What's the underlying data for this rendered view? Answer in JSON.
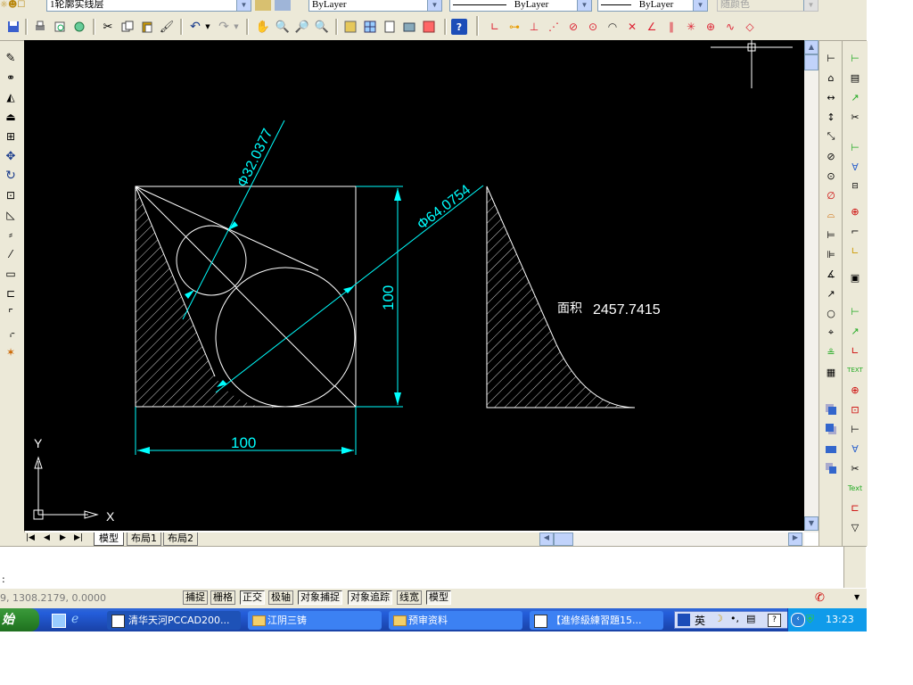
{
  "toolbar_top": {
    "layer_combo": "1轮廓实线层",
    "color_combo": "ByLayer",
    "linetype_combo": "ByLayer",
    "lineweight_combo": "ByLayer",
    "plotstyle_combo": "随颜色"
  },
  "drawing": {
    "dim_diameter_small": "Φ32.0377",
    "dim_diameter_large": "Φ64.0754",
    "dim_vertical": "100",
    "dim_horizontal": "100",
    "area_label": "面积",
    "area_value": "2457.7415",
    "ucs_y": "Y",
    "ucs_x": "X"
  },
  "layout_tabs": [
    "模型",
    "布局1",
    "布局2"
  ],
  "command": {
    "prompt": ":"
  },
  "status": {
    "coords": "9,  1308.2179,  0.0000",
    "buttons": [
      "捕捉",
      "栅格",
      "正交",
      "极轴",
      "对象捕捉",
      "对象追踪",
      "线宽",
      "模型"
    ]
  },
  "taskbar": {
    "start_label": "始",
    "tasks": [
      "清华天河PCCAD200...",
      "江阴三铸",
      "预审资料",
      "【進修級練習題15..."
    ],
    "ime_label": "英",
    "clock": "13:23"
  }
}
